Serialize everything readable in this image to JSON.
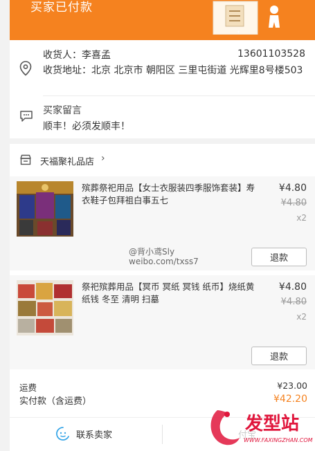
{
  "banner": {
    "title": "买家已付款"
  },
  "address": {
    "receiver_label": "收货人：",
    "receiver_name": "李喜孟",
    "phone": "13601103528",
    "address_label": "收货地址：",
    "address_text": "北京 北京市 朝阳区 三里屯街道 光辉里8号楼503"
  },
  "buyer_message": {
    "label": "买家留言",
    "text": "顺丰！必须发顺丰！"
  },
  "shop": {
    "name": "天福聚礼品店"
  },
  "items": [
    {
      "title": "殡葬祭祀用品【女士衣服装四季服饰套装】寿衣鞋子包拜祖白事五七",
      "price": "¥4.80",
      "original_price": "¥4.80",
      "quantity": "x2",
      "refund_label": "退款"
    },
    {
      "title": "祭祀殡葬用品【冥币 冥纸 冥钱 纸币】烧纸黄纸钱 冬至 清明 扫墓",
      "price": "¥4.80",
      "original_price": "¥4.80",
      "quantity": "x2",
      "refund_label": "退款"
    }
  ],
  "watermark": {
    "line1": "@背小鸢Sly",
    "line2": "weibo.com/txss7"
  },
  "fees": {
    "shipping_label": "运费",
    "shipping_value": "¥23.00",
    "paid_label": "实付款（含运费）",
    "paid_value": "¥42.20"
  },
  "bottom": {
    "contact_label": "联系卖家",
    "right_label": "付宝"
  },
  "logo": {
    "text": "发型站",
    "url": "WWW.FAXINGZHAN.COM"
  },
  "colors": {
    "accent": "#f5821f",
    "logo_red": "#e0163c"
  }
}
